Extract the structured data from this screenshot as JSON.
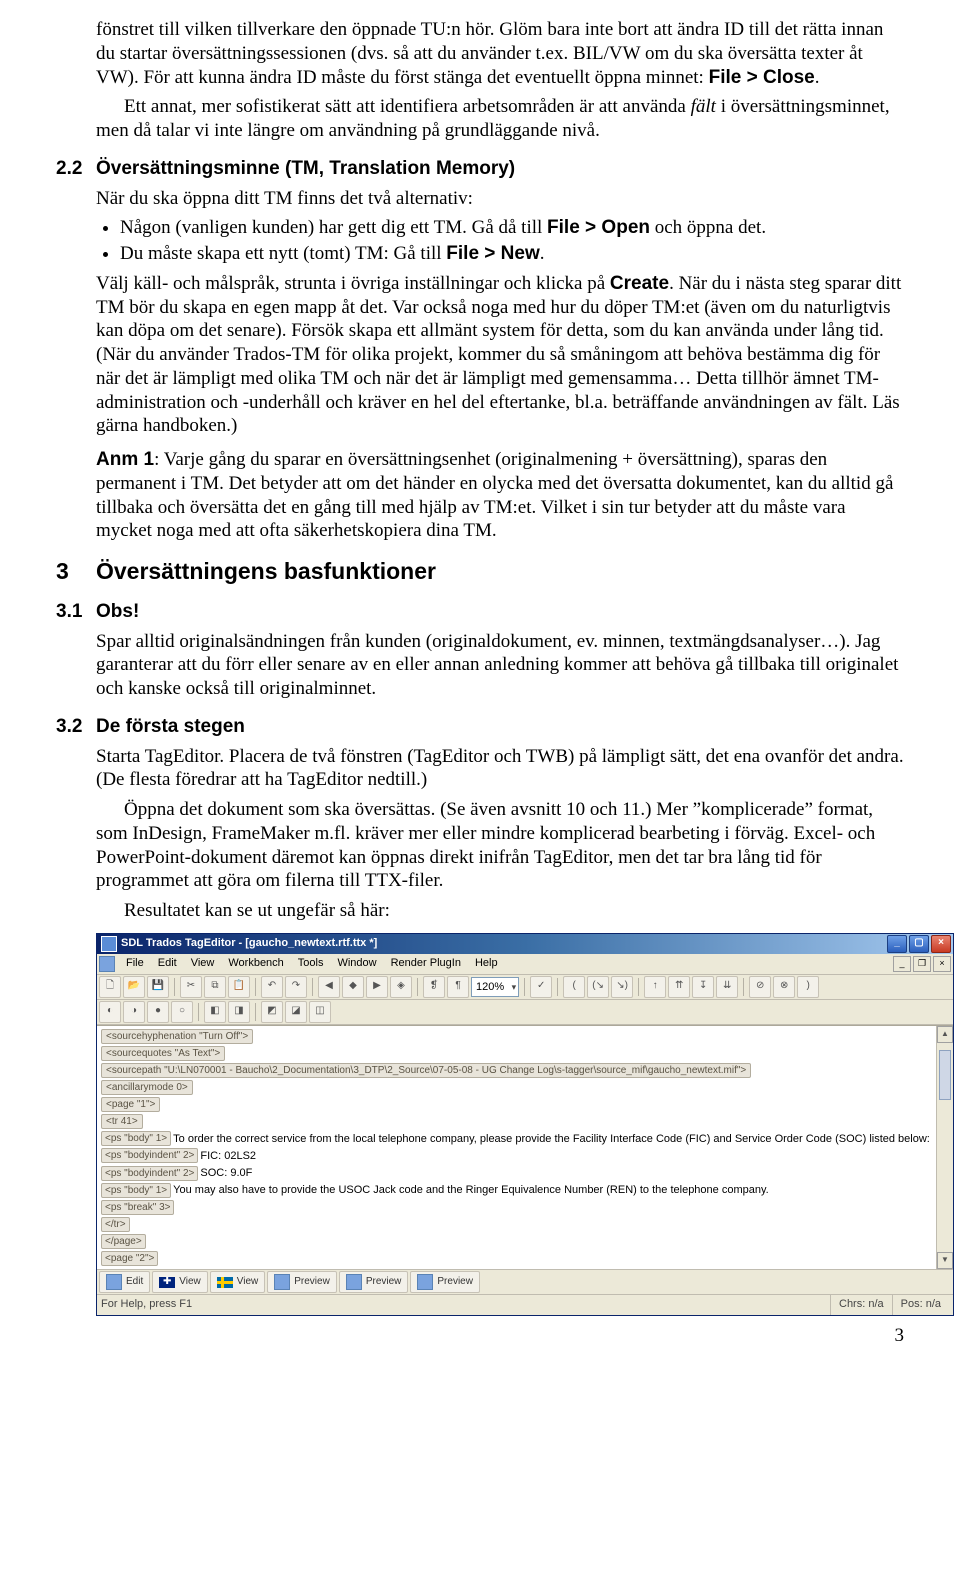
{
  "intro": {
    "p1": "fönstret till vilken tillverkare den öppnade TU:n hör. Glöm bara inte bort att ändra ID till det rätta innan du startar översättningssessionen (dvs. så att du använder t.ex. BIL/VW om du ska översätta texter åt VW). För att kunna ändra ID måste du först stänga det eventuellt öppna minnet: ",
    "p1_bold": "File > Close",
    "p1_end": ".",
    "p2a": "Ett annat, mer sofistikerat sätt att identifiera arbetsområden är att använda ",
    "p2_italic": "fält",
    "p2b": " i översättningsminnet, men då talar vi inte längre om användning på grundläggande nivå."
  },
  "s22": {
    "num": "2.2",
    "title": "Översättningsminne (TM, Translation Memory)",
    "lead": "När du ska öppna ditt TM finns det två alternativ:",
    "b1a": "Någon (vanligen kunden) har gett dig ett TM. Gå då till ",
    "b1_bold": "File > Open",
    "b1b": " och öppna det.",
    "b2a": "Du måste skapa ett nytt (tomt) TM: Gå till ",
    "b2_bold": "File > New",
    "b2b": ".",
    "p3a": "Välj käll- och målspråk, strunta i övriga inställningar och klicka på ",
    "p3_bold": "Create",
    "p3b": ". När du i nästa steg sparar ditt TM bör du skapa en egen mapp åt det. Var också noga med hur du döper TM:et (även om du naturligtvis kan döpa om det senare). Försök skapa ett allmänt system för detta, som du kan använda under lång tid. (När du använder Trados-TM för olika projekt, kommer du så småningom att behöva bestämma dig för när det är lämpligt med olika TM och när det är lämpligt med gemensamma… Detta tillhör ämnet TM-administration och -underhåll och kräver en hel del eftertanke, bl.a. beträffande användningen av fält. Läs gärna handboken.)",
    "p4_bold": "Anm 1",
    "p4": ": Varje gång du sparar en översättningsenhet (originalmening + översättning), sparas den permanent i TM. Det betyder att om det händer en olycka med det översatta dokumentet, kan du alltid gå tillbaka och översätta det en gång till med hjälp av TM:et. Vilket i sin tur betyder att du måste vara mycket noga med att ofta säkerhetskopiera dina TM."
  },
  "s3": {
    "num": "3",
    "title": "Översättningens basfunktioner"
  },
  "s31": {
    "num": "3.1",
    "title": "Obs!",
    "p": "Spar alltid originalsändningen från kunden (originaldokument, ev. minnen, textmängds­analyser…). Jag garanterar att du förr eller senare av en eller annan anledning kommer att behöva gå tillbaka till originalet och kanske också till originalminnet."
  },
  "s32": {
    "num": "3.2",
    "title": "De första stegen",
    "p1": "Starta TagEditor. Placera de två fönstren (TagEditor och TWB) på lämpligt sätt, det ena ovanför det andra. (De flesta föredrar att ha TagEditor nedtill.)",
    "p2": "Öppna det dokument som ska översättas. (Se även avsnitt 10 och 11.) Mer ”komplicerade” format, som InDesign, FrameMaker m.fl. kräver mer eller mindre komplicerad bearbeting i förväg. Excel- och PowerPoint-dokument däremot kan öppnas direkt inifrån TagEditor, men det tar bra lång tid för programmet att göra om filerna till TTX-filer.",
    "p3": "Resultatet kan se ut ungefär så här:"
  },
  "app": {
    "title": "SDL Trados TagEditor - [gaucho_newtext.rtf.ttx *]",
    "menus": [
      "File",
      "Edit",
      "View",
      "Workbench",
      "Tools",
      "Window",
      "Render PlugIn",
      "Help"
    ],
    "zoom": "120%",
    "doc": {
      "l0": "<sourcehyphenation \"Turn Off\">",
      "l1": "<sourcequotes \"As Text\">",
      "l2": "<sourcepath \"U:\\LN070001 - Baucho\\2_Documentation\\3_DTP\\2_Source\\07-05-08 - UG Change Log\\s-tagger\\source_mif\\gaucho_newtext.mif\">",
      "l3": "<ancillarymode 0>",
      "l4": "<page \"1\">",
      "l5": "<tr 41>",
      "l6_tag": "<ps \"body\" 1>",
      "l6_text": "To order the correct service from the local telephone company, please provide the Facility Interface Code (FIC) and Service Order Code (SOC) listed below:",
      "l7_tag": "<ps \"bodyindent\" 2>",
      "l7_text": "FIC: 02LS2",
      "l8_tag": "<ps \"bodyindent\" 2>",
      "l8_text": "SOC: 9.0F",
      "l9_tag": "<ps \"body\" 1>",
      "l9_text": "You may also have to provide the USOC Jack code and the Ringer Equivalence Number (REN) to the telephone company.",
      "l10": "<ps \"break\" 3>",
      "l11": "</tr>",
      "l12": "</page>",
      "l13": "<page \"2\">"
    },
    "bottom": {
      "edit": "Edit",
      "view": "View",
      "preview1": "Preview",
      "preview2": "Preview",
      "preview3": "Preview"
    },
    "status": {
      "left": "For Help, press F1",
      "chrs": "Chrs: n/a",
      "pos": "Pos: n/a"
    }
  },
  "page_number": "3"
}
